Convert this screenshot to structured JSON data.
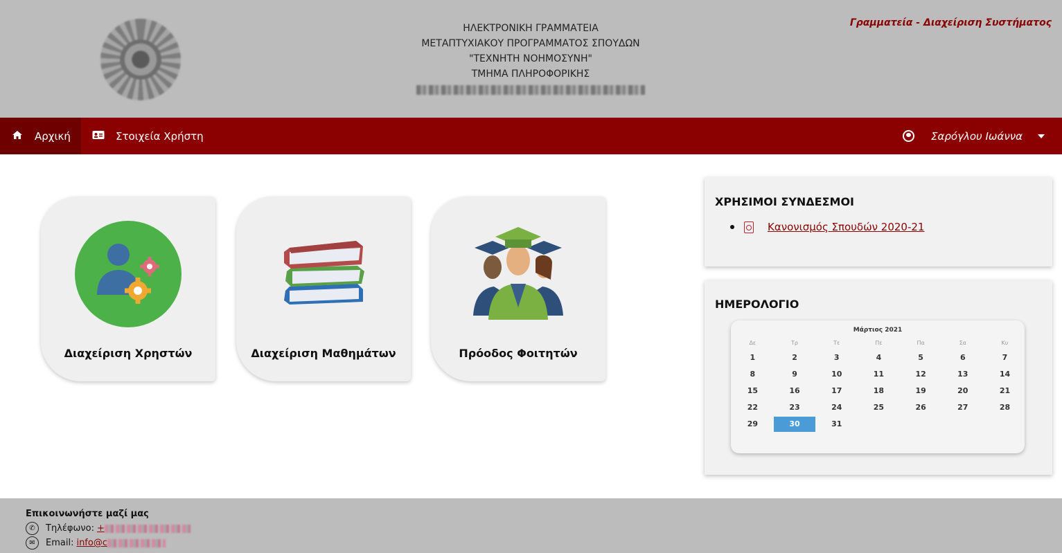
{
  "header": {
    "lines": [
      "ΗΛΕΚΤΡΟΝΙΚΗ ΓΡΑΜΜΑΤΕΙΑ",
      "ΜΕΤΑΠΤΥΧΙΑΚΟΥ ΠΡΟΓΡΑΜΜΑΤΟΣ ΣΠΟΥΔΩΝ",
      "\"ΤΕΧΝΗΤΗ ΝΟΗΜΟΣΥΝΗ\"",
      "ΤΜΗΜΑ ΠΛΗΡΟΦΟΡΙΚΗΣ"
    ],
    "system_title": "Γραμματεία - Διαχείριση Συστήματος"
  },
  "nav": {
    "home_label": "Αρχική",
    "user_details_label": "Στοιχεία Χρήστη",
    "user_name": "Σαρόγλου Ιωάννα"
  },
  "cards": [
    {
      "label": "Διαχείριση Χρηστών"
    },
    {
      "label": "Διαχείριση Μαθημάτων"
    },
    {
      "label": "Πρόοδος Φοιτητών"
    }
  ],
  "links_panel": {
    "title": "ΧΡΗΣΙΜΟΙ ΣΥΝΔΕΣΜΟΙ",
    "items": [
      {
        "label": "Κανονισμός Σπουδών 2020-21"
      }
    ]
  },
  "calendar_panel": {
    "title": "ΗΜΕΡΟΛΟΓΙΟ",
    "month": "Μάρτιος 2021",
    "weekdays": [
      "Δε",
      "Τρ",
      "Τε",
      "Πε",
      "Πα",
      "Σα",
      "Κυ"
    ],
    "weeks": [
      [
        "1",
        "2",
        "3",
        "4",
        "5",
        "6",
        "7"
      ],
      [
        "8",
        "9",
        "10",
        "11",
        "12",
        "13",
        "14"
      ],
      [
        "15",
        "16",
        "17",
        "18",
        "19",
        "20",
        "21"
      ],
      [
        "22",
        "23",
        "24",
        "25",
        "26",
        "27",
        "28"
      ],
      [
        "29",
        "30",
        "31",
        "",
        "",
        "",
        ""
      ]
    ],
    "selected_day": "30",
    "selected_color": "#4a9bd6"
  },
  "footer": {
    "contact_title": "Επικοινωνήστε μαζί μας",
    "phone_label": "Τηλέφωνο:",
    "phone_prefix": "+",
    "email_label": "Email:",
    "email_prefix": "info@c"
  },
  "colors": {
    "brand": "#8b0000",
    "header_bg": "#bcbcbc",
    "active_nav": "#6e0000"
  }
}
